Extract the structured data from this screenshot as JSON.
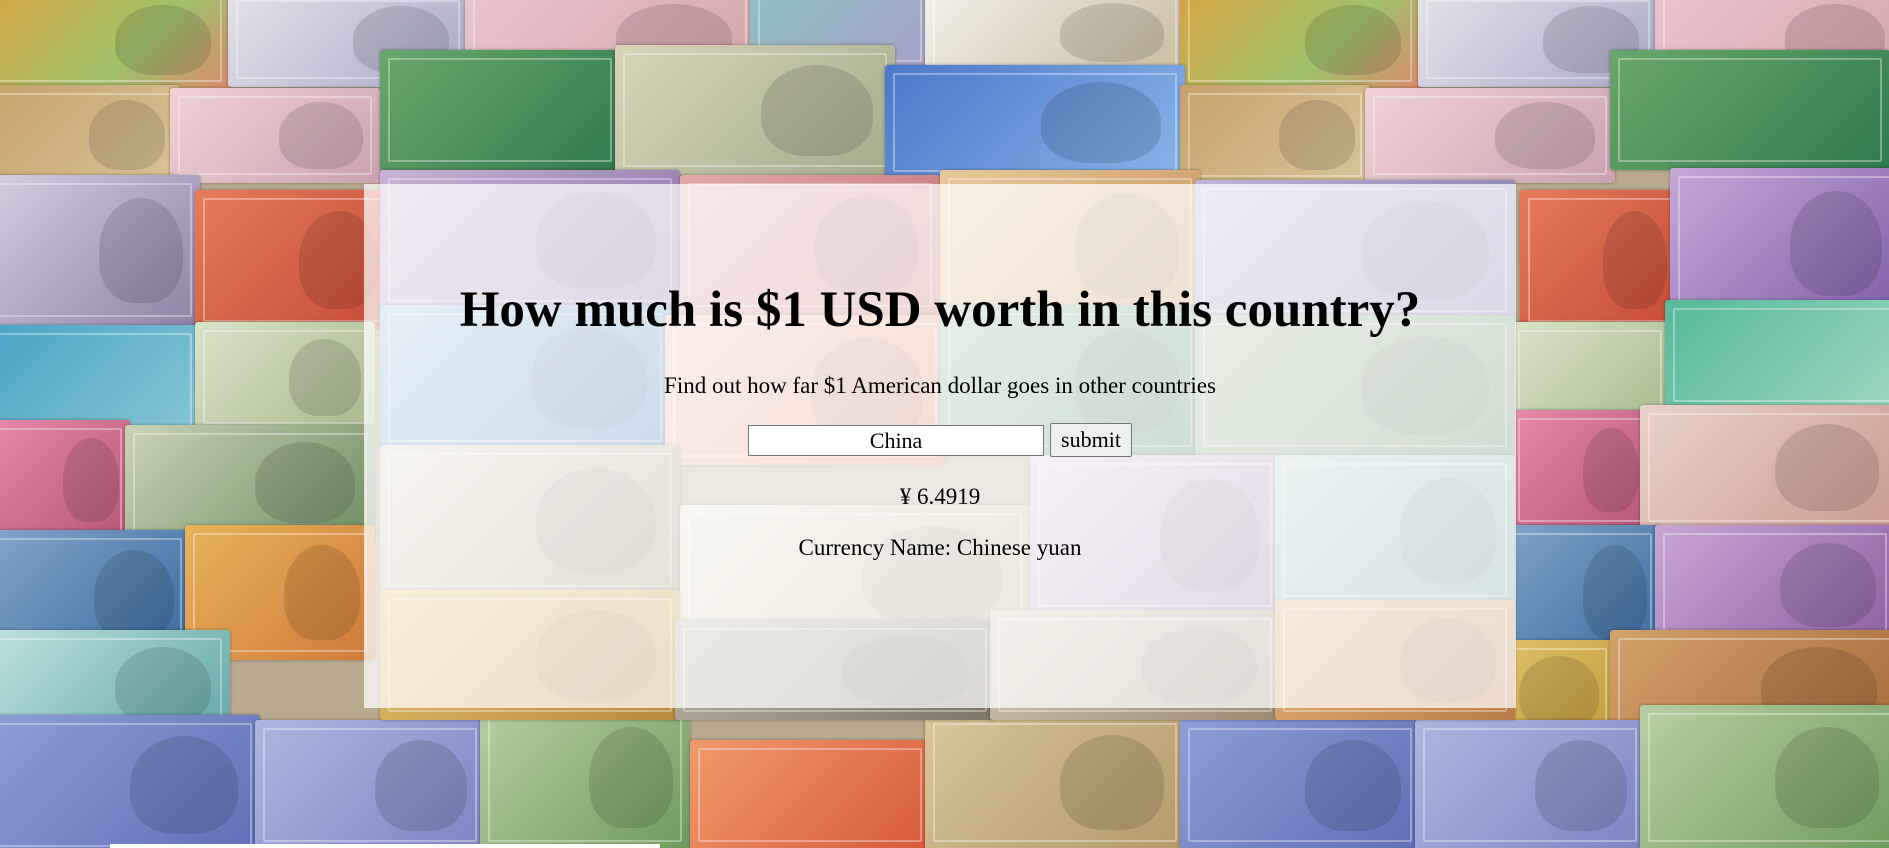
{
  "page": {
    "title": "How much is $1 USD worth in this country?",
    "subtitle": "Find out how far $1 American dollar goes in other countries"
  },
  "form": {
    "country_value": "China",
    "submit_label": "submit"
  },
  "result": {
    "rate": "¥ 6.4919",
    "currency_name": "Currency Name: Chinese yuan"
  },
  "colors": {
    "panel": "#ffffffb8",
    "text": "#000000"
  }
}
